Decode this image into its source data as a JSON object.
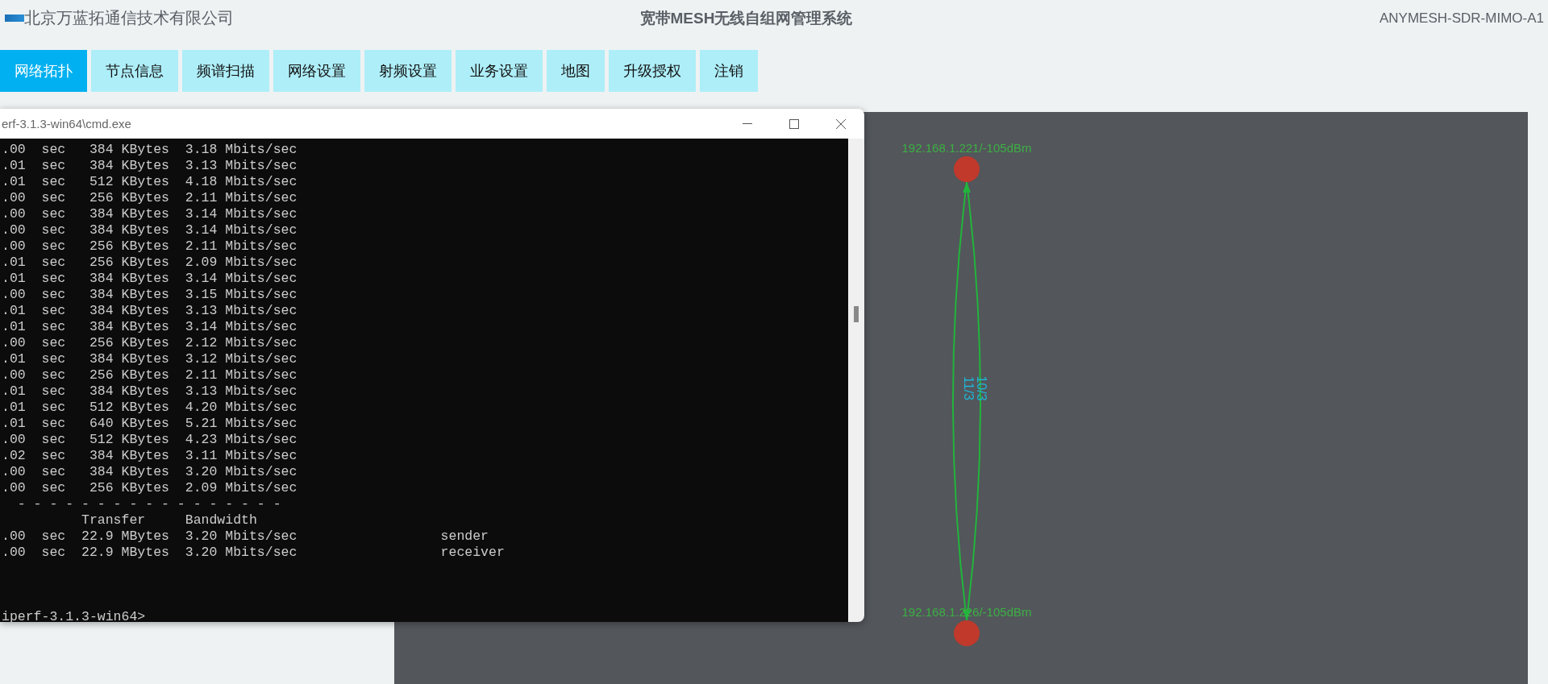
{
  "header": {
    "company": "北京万蓝拓通信技术有限公司",
    "title": "宽带MESH无线自组网管理系统",
    "model": "ANYMESH-SDR-MIMO-A1"
  },
  "nav": [
    {
      "label": "网络拓扑",
      "selected": true
    },
    {
      "label": "节点信息",
      "selected": false
    },
    {
      "label": "频谱扫描",
      "selected": false
    },
    {
      "label": "网络设置",
      "selected": false
    },
    {
      "label": "射频设置",
      "selected": false
    },
    {
      "label": "业务设置",
      "selected": false
    },
    {
      "label": "地图",
      "selected": false
    },
    {
      "label": "升级授权",
      "selected": false
    },
    {
      "label": "注销",
      "selected": false
    }
  ],
  "terminal": {
    "title": "erf-3.1.3-win64\\cmd.exe",
    "lines": [
      ".00  sec   384 KBytes  3.18 Mbits/sec",
      ".01  sec   384 KBytes  3.13 Mbits/sec",
      ".01  sec   512 KBytes  4.18 Mbits/sec",
      ".00  sec   256 KBytes  2.11 Mbits/sec",
      ".00  sec   384 KBytes  3.14 Mbits/sec",
      ".00  sec   384 KBytes  3.14 Mbits/sec",
      ".00  sec   256 KBytes  2.11 Mbits/sec",
      ".01  sec   256 KBytes  2.09 Mbits/sec",
      ".01  sec   384 KBytes  3.14 Mbits/sec",
      ".00  sec   384 KBytes  3.15 Mbits/sec",
      ".01  sec   384 KBytes  3.13 Mbits/sec",
      ".01  sec   384 KBytes  3.14 Mbits/sec",
      ".00  sec   256 KBytes  2.12 Mbits/sec",
      ".01  sec   384 KBytes  3.12 Mbits/sec",
      ".00  sec   256 KBytes  2.11 Mbits/sec",
      ".01  sec   384 KBytes  3.13 Mbits/sec",
      ".01  sec   512 KBytes  4.20 Mbits/sec",
      ".01  sec   640 KBytes  5.21 Mbits/sec",
      ".00  sec   512 KBytes  4.23 Mbits/sec",
      ".02  sec   384 KBytes  3.11 Mbits/sec",
      ".00  sec   384 KBytes  3.20 Mbits/sec",
      ".00  sec   256 KBytes  2.09 Mbits/sec",
      "  - - - - - - - - - - - - - - - - -",
      "          Transfer     Bandwidth",
      ".00  sec  22.9 MBytes  3.20 Mbits/sec                  sender",
      ".00  sec  22.9 MBytes  3.20 Mbits/sec                  receiver"
    ],
    "prompt": "iperf-3.1.3-win64>"
  },
  "topology": {
    "nodes": [
      {
        "label": "192.168.1.221/-105dBm"
      },
      {
        "label": "192.168.1.226/-105dBm"
      }
    ],
    "links": [
      {
        "label": "10/3"
      },
      {
        "label": "11/3"
      }
    ]
  }
}
